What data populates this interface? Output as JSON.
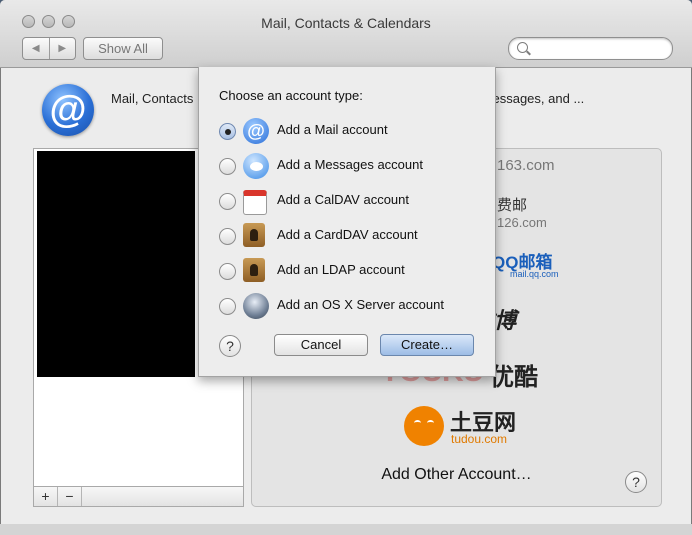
{
  "window": {
    "title": "Mail, Contacts & Calendars"
  },
  "toolbar": {
    "back_label": "◀",
    "forward_label": "▶",
    "show_all_label": "Show All",
    "search_placeholder": ""
  },
  "main": {
    "description": "Mail, Contacts ... accounts to use with Mail, Contacts, Calendar, Messages, and ...",
    "providers": {
      "p163": "163.com",
      "p126_cn": "费邮",
      "p126": "126.com",
      "qq": "QQ邮箱",
      "qq_sub": "mail.qq.com",
      "weibo": "微博",
      "youku": "YOUKU",
      "youku_cn": "优酷",
      "tudou": "土豆网",
      "tudou_sub": "tudou.com"
    },
    "add_other_label": "Add Other Account…",
    "help_label": "?",
    "list_add": "+",
    "list_remove": "−"
  },
  "sheet": {
    "title": "Choose an account type:",
    "options": [
      {
        "label": "Add a Mail account",
        "selected": true
      },
      {
        "label": "Add a Messages account",
        "selected": false
      },
      {
        "label": "Add a CalDAV account",
        "selected": false
      },
      {
        "label": "Add a CardDAV account",
        "selected": false
      },
      {
        "label": "Add an LDAP account",
        "selected": false
      },
      {
        "label": "Add an OS X Server account",
        "selected": false
      }
    ],
    "help_label": "?",
    "cancel_label": "Cancel",
    "create_label": "Create…"
  },
  "colors": {
    "accent": "#2b6fd8",
    "tudou": "#f08200",
    "youku": "#d41c1c"
  }
}
